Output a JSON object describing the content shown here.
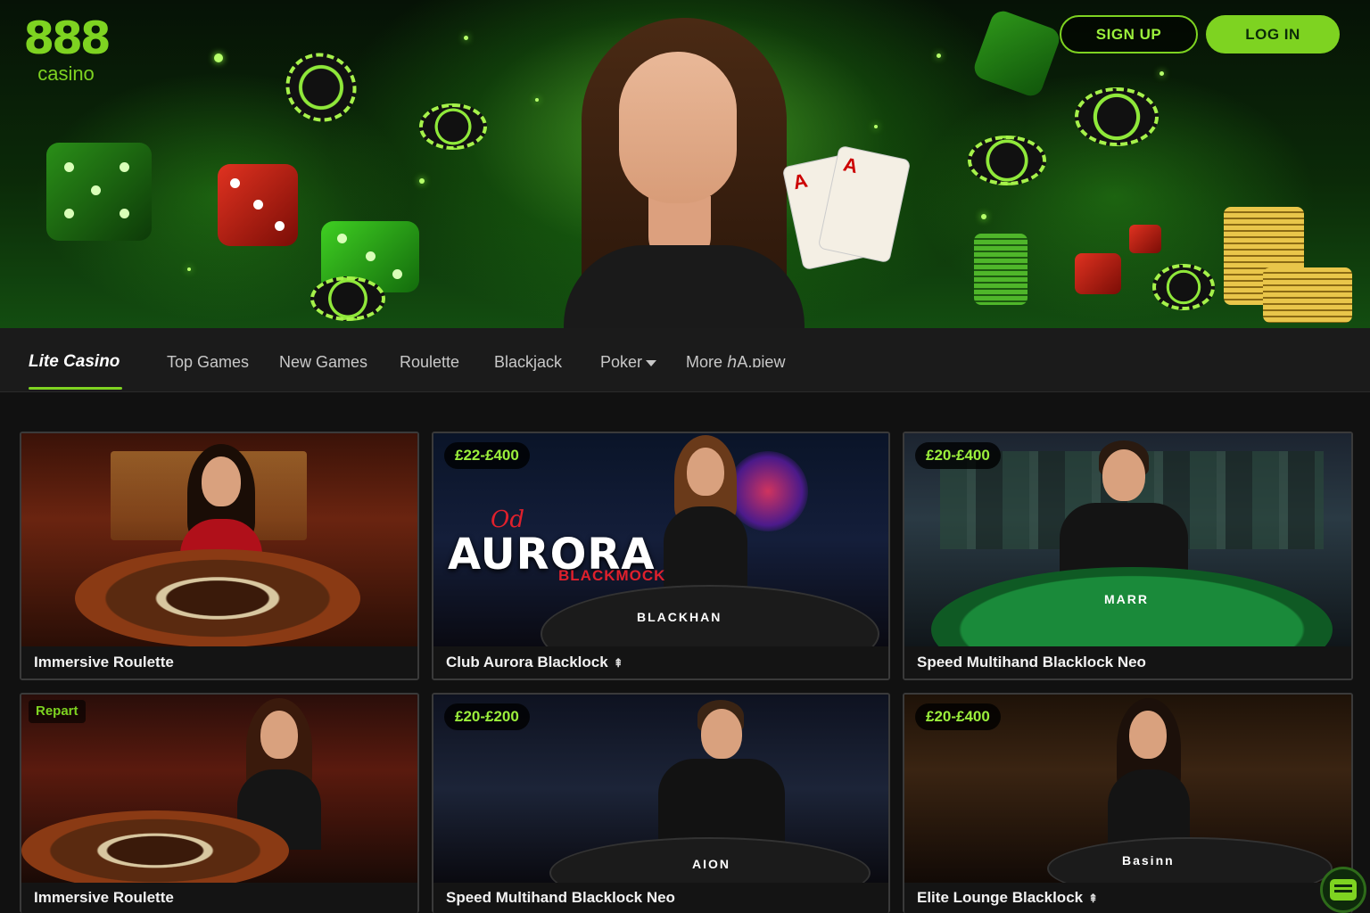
{
  "brand": {
    "logo_mark": "888",
    "logo_text": "casino",
    "accent_color": "#7ed321"
  },
  "header": {
    "signup_label": "SIGN UP",
    "login_label": "LOG IN"
  },
  "nav": {
    "active_label": "Lite Casino",
    "items": [
      "Top Games",
      "New Games",
      "Roulette",
      "Blackjack",
      "Poker",
      "More ℎA.ɒiew"
    ]
  },
  "games": [
    {
      "title": "Immersive Roulette",
      "limit": ""
    },
    {
      "title": "Club Aurora Blacklock",
      "limit": "£22-£400",
      "logo_script": "Od",
      "logo_title": "AURORA",
      "logo_sub": "BLACKMOCK",
      "felt_text": "BLACKHAN"
    },
    {
      "title": "Speed Multihand Blacklock Neo",
      "limit": "£20-£400",
      "felt_text": "MARR"
    },
    {
      "title": "Immersive Roulette",
      "limit": "",
      "badge": "Repart"
    },
    {
      "title": "Speed Multihand Blacklock Neo",
      "limit": "£20-£200",
      "felt_text": "AION"
    },
    {
      "title": "Elite Lounge Blacklock",
      "limit": "£20-£400",
      "felt_text": "Basinn"
    }
  ],
  "icons": {
    "chat": "chat-bubble-icon",
    "caret": "chevron-down-icon",
    "upgrade": "up-arrow-icon"
  }
}
